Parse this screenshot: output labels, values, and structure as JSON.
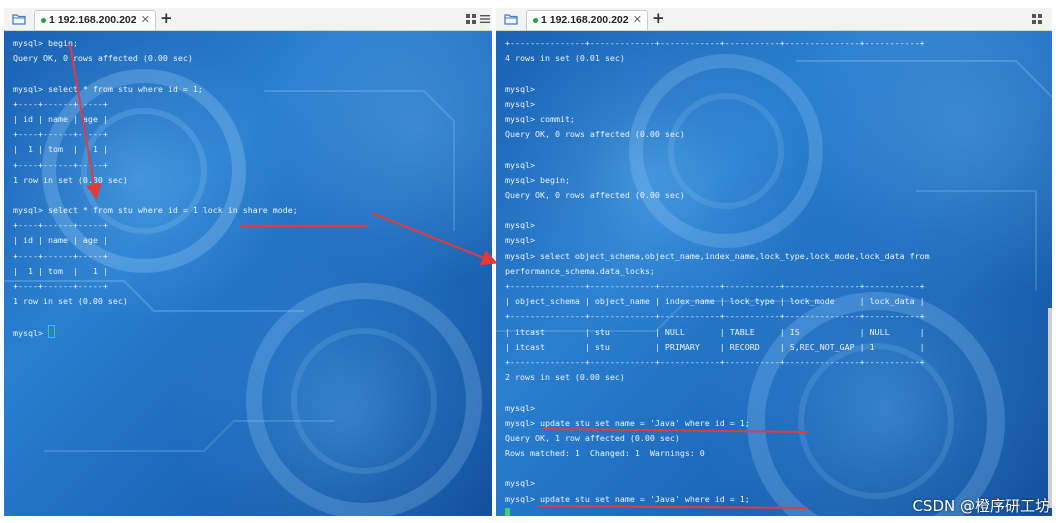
{
  "left": {
    "tab": {
      "title": "1 192.168.200.202",
      "close": "✕",
      "add": "+"
    },
    "lines": [
      "mysql> begin;",
      "Query OK, 0 rows affected (0.00 sec)",
      "",
      "mysql> select * from stu where id = 1;",
      "+----+------+-----+",
      "| id | name | age |",
      "+----+------+-----+",
      "|  1 | tom  |   1 |",
      "+----+------+-----+",
      "1 row in set (0.00 sec)",
      "",
      "mysql> select * from stu where id = 1 lock in share mode;",
      "+----+------+-----+",
      "| id | name | age |",
      "+----+------+-----+",
      "|  1 | tom  |   1 |",
      "+----+------+-----+",
      "1 row in set (0.00 sec)",
      "",
      "mysql> "
    ]
  },
  "right": {
    "tab": {
      "title": "1 192.168.200.202",
      "close": "✕",
      "add": "+"
    },
    "lines": [
      "+---------------+-------------+------------+-----------+---------------+-----------+",
      "4 rows in set (0.01 sec)",
      "",
      "mysql>",
      "mysql>",
      "mysql> commit;",
      "Query OK, 0 rows affected (0.00 sec)",
      "",
      "mysql>",
      "mysql> begin;",
      "Query OK, 0 rows affected (0.00 sec)",
      "",
      "mysql>",
      "mysql>",
      "mysql> select object_schema,object_name,index_name,lock_type,lock_mode,lock_data from",
      "performance_schema.data_locks;",
      "+---------------+-------------+------------+-----------+---------------+-----------+",
      "| object_schema | object_name | index_name | lock_type | lock_mode     | lock_data |",
      "+---------------+-------------+------------+-----------+---------------+-----------+",
      "| itcast        | stu         | NULL       | TABLE     | IS            | NULL      |",
      "| itcast        | stu         | PRIMARY    | RECORD    | S,REC_NOT_GAP | 1         |",
      "+---------------+-------------+------------+-----------+---------------+-----------+",
      "2 rows in set (0.00 sec)",
      "",
      "mysql>",
      "mysql> update stu set name = 'Java' where id = 1;",
      "Query OK, 1 row affected (0.00 sec)",
      "Rows matched: 1  Changed: 1  Warnings: 0",
      "",
      "mysql>",
      "mysql> update stu set name = 'Java' where id = 1;",
      ""
    ]
  },
  "watermark": "CSDN @橙序研工坊",
  "colors": {
    "annotation": "#e53a3a",
    "terminal_text": "#e9f3ff",
    "cursor": "#3bd36e"
  },
  "icons": [
    "folder-icon",
    "grid-icon",
    "menu-icon"
  ]
}
